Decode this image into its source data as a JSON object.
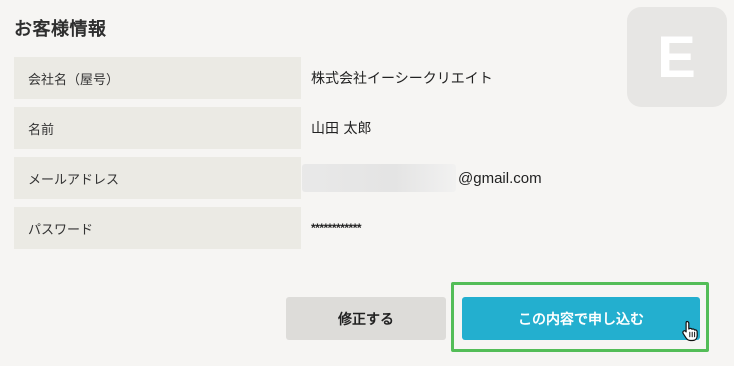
{
  "section": {
    "title": "お客様情報"
  },
  "avatar": {
    "initial": "E",
    "background": "#e7e6e4"
  },
  "fields": [
    {
      "label": "会社名（屋号）",
      "value": "株式会社イーシークリエイト"
    },
    {
      "label": "名前",
      "value": "山田 太郎"
    },
    {
      "label": "メールアドレス",
      "value_visible": "@gmail.com"
    },
    {
      "label": "パスワード",
      "value": "************"
    }
  ],
  "buttons": {
    "edit_label": "修正する",
    "submit_label": "この内容で申し込む"
  },
  "colors": {
    "accent": "#23afcf",
    "highlight_frame": "#53bd57",
    "label_background": "#ebeae4",
    "page_background": "#f6f5f3"
  },
  "icons": {
    "cursor": "hand-pointer-icon"
  }
}
